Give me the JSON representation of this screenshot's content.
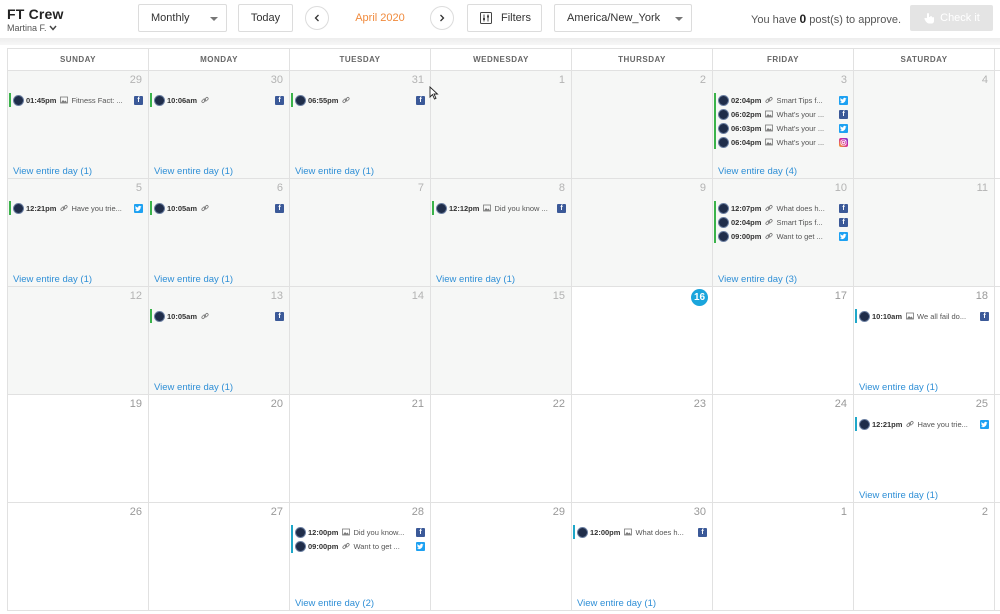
{
  "header": {
    "title": "FT Crew",
    "user": "Martina F.",
    "view_select": "Monthly",
    "today_label": "Today",
    "month_label": "April 2020",
    "filters_label": "Filters",
    "timezone": "America/New_York",
    "approve_prefix": "You have",
    "approve_count": "0",
    "approve_suffix": "post(s) to approve.",
    "check_label": "Check it"
  },
  "calendar": {
    "days_of_week": [
      "SUNDAY",
      "MONDAY",
      "TUESDAY",
      "WEDNESDAY",
      "THURSDAY",
      "FRIDAY",
      "SATURDAY"
    ],
    "today": 16,
    "weeks": [
      [
        {
          "num": "29",
          "past": true,
          "posts": [
            {
              "time": "01:45pm",
              "type": "image",
              "text": "Fitness Fact: ...",
              "net": "fb"
            }
          ],
          "view": "View entire day (1)"
        },
        {
          "num": "30",
          "past": true,
          "posts": [
            {
              "time": "10:06am",
              "type": "link",
              "text": "",
              "net": "fb"
            }
          ],
          "view": "View entire day (1)"
        },
        {
          "num": "31",
          "past": true,
          "posts": [
            {
              "time": "06:55pm",
              "type": "link",
              "text": "",
              "net": "fb"
            }
          ],
          "view": "View entire day (1)"
        },
        {
          "num": "1",
          "past": true,
          "posts": [],
          "view": ""
        },
        {
          "num": "2",
          "past": true,
          "posts": [],
          "view": ""
        },
        {
          "num": "3",
          "past": true,
          "posts": [
            {
              "time": "02:04pm",
              "type": "link",
              "text": "Smart Tips f...",
              "net": "tw"
            },
            {
              "time": "06:02pm",
              "type": "image",
              "text": "What's your ...",
              "net": "fb"
            },
            {
              "time": "06:03pm",
              "type": "image",
              "text": "What's your ...",
              "net": "tw"
            },
            {
              "time": "06:04pm",
              "type": "image",
              "text": "What's your ...",
              "net": "ig"
            }
          ],
          "view": "View entire day (4)"
        },
        {
          "num": "4",
          "past": true,
          "posts": [],
          "view": ""
        }
      ],
      [
        {
          "num": "5",
          "past": true,
          "posts": [
            {
              "time": "12:21pm",
              "type": "link",
              "text": "Have you trie...",
              "net": "tw"
            }
          ],
          "view": "View entire day (1)"
        },
        {
          "num": "6",
          "past": true,
          "posts": [
            {
              "time": "10:05am",
              "type": "link",
              "text": "",
              "net": "fb"
            }
          ],
          "view": "View entire day (1)"
        },
        {
          "num": "7",
          "past": true,
          "posts": [],
          "view": ""
        },
        {
          "num": "8",
          "past": true,
          "posts": [
            {
              "time": "12:12pm",
              "type": "image",
              "text": "Did you know ...",
              "net": "fb"
            }
          ],
          "view": "View entire day (1)"
        },
        {
          "num": "9",
          "past": true,
          "posts": [],
          "view": ""
        },
        {
          "num": "10",
          "past": true,
          "posts": [
            {
              "time": "12:07pm",
              "type": "link",
              "text": "What does h...",
              "net": "fb"
            },
            {
              "time": "02:04pm",
              "type": "link",
              "text": "Smart Tips f...",
              "net": "fb"
            },
            {
              "time": "09:00pm",
              "type": "link",
              "text": "Want to get ...",
              "net": "tw"
            }
          ],
          "view": "View entire day (3)"
        },
        {
          "num": "11",
          "past": true,
          "posts": [],
          "view": ""
        }
      ],
      [
        {
          "num": "12",
          "past": true,
          "posts": [],
          "view": ""
        },
        {
          "num": "13",
          "past": true,
          "posts": [
            {
              "time": "10:05am",
              "type": "link",
              "text": "",
              "net": "fb"
            }
          ],
          "view": "View entire day (1)"
        },
        {
          "num": "14",
          "past": true,
          "posts": [],
          "view": ""
        },
        {
          "num": "15",
          "past": true,
          "posts": [],
          "view": ""
        },
        {
          "num": "16",
          "past": false,
          "posts": [],
          "view": ""
        },
        {
          "num": "17",
          "past": false,
          "posts": [],
          "view": ""
        },
        {
          "num": "18",
          "past": false,
          "posts": [
            {
              "time": "10:10am",
              "type": "image",
              "text": "We all fail do...",
              "net": "fb",
              "scheduled": true
            }
          ],
          "view": "View entire day (1)"
        }
      ],
      [
        {
          "num": "19",
          "past": false,
          "posts": [],
          "view": ""
        },
        {
          "num": "20",
          "past": false,
          "posts": [],
          "view": ""
        },
        {
          "num": "21",
          "past": false,
          "posts": [],
          "view": ""
        },
        {
          "num": "22",
          "past": false,
          "posts": [],
          "view": ""
        },
        {
          "num": "23",
          "past": false,
          "posts": [],
          "view": ""
        },
        {
          "num": "24",
          "past": false,
          "posts": [],
          "view": ""
        },
        {
          "num": "25",
          "past": false,
          "posts": [
            {
              "time": "12:21pm",
              "type": "link",
              "text": "Have you trie...",
              "net": "tw",
              "scheduled": true
            }
          ],
          "view": "View entire day (1)"
        }
      ],
      [
        {
          "num": "26",
          "past": false,
          "posts": [],
          "view": ""
        },
        {
          "num": "27",
          "past": false,
          "posts": [],
          "view": ""
        },
        {
          "num": "28",
          "past": false,
          "posts": [
            {
              "time": "12:00pm",
              "type": "image",
              "text": "Did you know...",
              "net": "fb",
              "scheduled": true
            },
            {
              "time": "09:00pm",
              "type": "link",
              "text": "Want to get ...",
              "net": "tw",
              "scheduled": true
            }
          ],
          "view": "View entire day (2)"
        },
        {
          "num": "29",
          "past": false,
          "posts": [],
          "view": ""
        },
        {
          "num": "30",
          "past": false,
          "posts": [
            {
              "time": "12:00pm",
              "type": "image",
              "text": "What does h...",
              "net": "fb",
              "scheduled": true
            }
          ],
          "view": "View entire day (1)"
        },
        {
          "num": "1",
          "past": false,
          "posts": [],
          "view": ""
        },
        {
          "num": "2",
          "past": false,
          "posts": [],
          "view": ""
        }
      ]
    ]
  },
  "colors": {
    "accent_blue": "#1aa5dc",
    "month_orange": "#f08a3c",
    "published_green": "#3ab34a",
    "scheduled_teal": "#1fa7c9",
    "link_blue": "#2f8fd6"
  }
}
